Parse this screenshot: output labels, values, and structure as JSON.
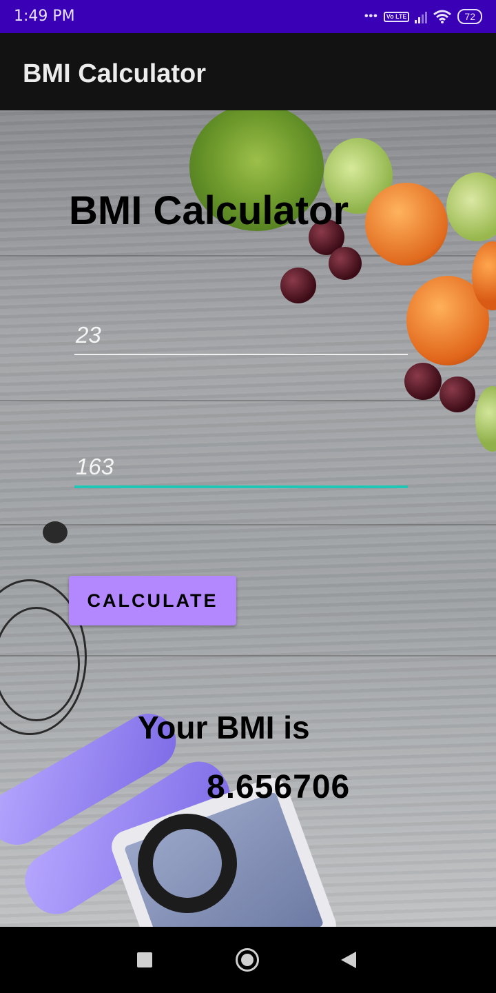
{
  "status_bar": {
    "time": "1:49 PM",
    "volte": "Vo LTE",
    "battery": "72"
  },
  "app_bar": {
    "title": "BMI Calculator"
  },
  "main": {
    "heading": "BMI Calculator",
    "input_1_value": "23",
    "input_2_value": "163",
    "calculate_label": "CALCULATE",
    "result_label": "Your BMI is",
    "result_value": "8.656706"
  },
  "colors": {
    "status_bar": "#3a00b5",
    "app_bar": "#121212",
    "button": "#b388ff",
    "focus_underline": "#1fc8b6"
  },
  "icons": [
    "recents-icon",
    "home-icon",
    "back-icon",
    "wifi-icon",
    "signal-icon",
    "battery-icon"
  ]
}
